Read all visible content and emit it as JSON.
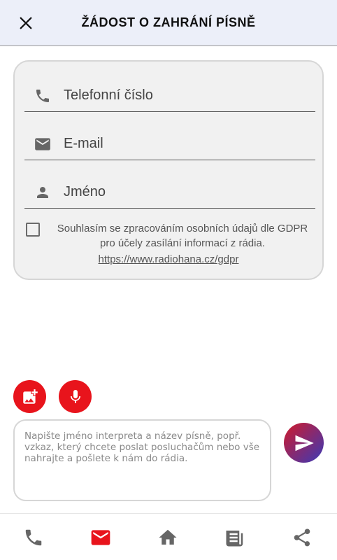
{
  "header": {
    "title": "ŽÁDOST O ZAHRÁNÍ PÍSNĚ",
    "close_icon": "close-icon"
  },
  "form": {
    "phone_placeholder": "Telefonní číslo",
    "email_placeholder": "E-mail",
    "name_placeholder": "Jméno",
    "consent_text": "Souhlasím se zpracováním osobních údajů dle GDPR pro účely zasílání informací z rádia.",
    "consent_checked": false,
    "gdpr_link": "https://www.radiohana.cz/gdpr"
  },
  "message": {
    "placeholder": "Napište jméno interpreta a název písně, popř. vzkaz, který chcete poslat posluchačům nebo vše nahrajte a pošlete k nám do rádia.",
    "value": ""
  },
  "buttons": {
    "add_image_icon": "add-photo-icon",
    "mic_icon": "microphone-icon",
    "send_icon": "send-icon"
  },
  "bottom_nav": {
    "items": [
      {
        "icon": "phone-icon",
        "active": false
      },
      {
        "icon": "mail-icon",
        "active": true
      },
      {
        "icon": "home-icon",
        "active": false
      },
      {
        "icon": "news-icon",
        "active": false
      },
      {
        "icon": "share-icon",
        "active": false
      }
    ]
  },
  "colors": {
    "accent": "#e8141c",
    "header_bg": "#eceff9",
    "icon_gray": "#666666",
    "send_gradient_start": "#d11a2a",
    "send_gradient_end": "#3a3ab8"
  }
}
